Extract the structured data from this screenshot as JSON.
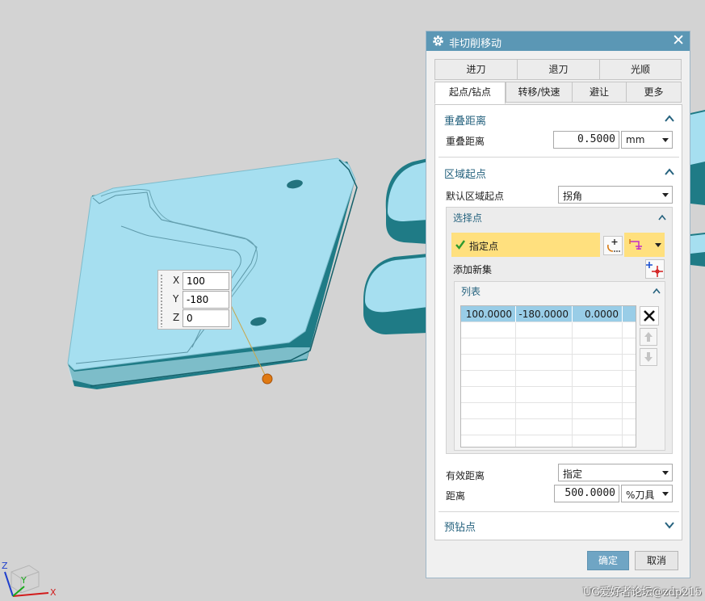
{
  "viewport": {
    "coord_box": {
      "x_label": "X",
      "x_value": "100",
      "y_label": "Y",
      "y_value": "-180",
      "z_label": "Z",
      "z_value": "0"
    },
    "triad": {
      "z": "Z",
      "y": "Y",
      "x": "X"
    }
  },
  "dialog": {
    "title": "非切削移动",
    "tabs_row1": [
      "进刀",
      "退刀",
      "光顺"
    ],
    "tabs_row2": [
      "起点/钻点",
      "转移/快速",
      "避让",
      "更多"
    ],
    "active_tab": "起点/钻点",
    "overlap": {
      "section_title": "重叠距离",
      "field_label": "重叠距离",
      "value": "0.5000",
      "unit": "mm"
    },
    "region_start": {
      "section_title": "区域起点",
      "default_label": "默认区域起点",
      "default_value": "拐角",
      "select_point": {
        "title": "选择点",
        "specify_label": "指定点",
        "add_new_set": "添加新集",
        "list": {
          "title": "列表",
          "rows": [
            [
              "100.0000",
              "-180.0000",
              "0.0000"
            ]
          ]
        }
      },
      "effective_distance_label": "有效距离",
      "effective_distance_value": "指定",
      "distance_label": "距离",
      "distance_value": "500.0000",
      "distance_unit": "%刀具"
    },
    "predrill": {
      "section_title": "预钻点"
    },
    "ok_label": "确定",
    "cancel_label": "取消"
  },
  "watermark": "UG爱好者论坛@zdp215",
  "colors": {
    "titlebar": "#5b97b5",
    "part": "#a7e1ef",
    "part_side": "#207e89",
    "highlight": "#ffe07e",
    "selection": "#99cde7",
    "section_text": "#25627e"
  }
}
